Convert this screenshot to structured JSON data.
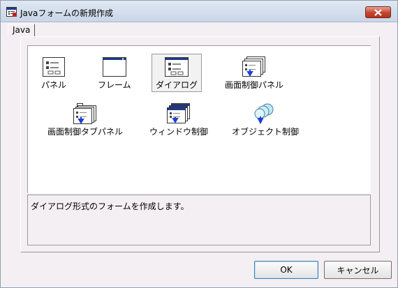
{
  "window": {
    "title": "Javaフォームの新規作成",
    "app_icon": "form-window-icon",
    "close_icon": "close-icon"
  },
  "tabs": [
    {
      "label": "Java",
      "active": true
    }
  ],
  "items": [
    {
      "label": "パネル",
      "icon": "panel-icon",
      "selected": false
    },
    {
      "label": "フレーム",
      "icon": "frame-icon",
      "selected": false
    },
    {
      "label": "ダイアログ",
      "icon": "dialog-icon",
      "selected": true
    },
    {
      "label": "画面制御パネル",
      "icon": "screen-control-panel-icon",
      "selected": false
    },
    {
      "label": "画面制御タブパネル",
      "icon": "screen-control-tab-panel-icon",
      "selected": false
    },
    {
      "label": "ウィンドウ制御",
      "icon": "window-control-icon",
      "selected": false
    },
    {
      "label": "オブジェクト制御",
      "icon": "object-control-icon",
      "selected": false
    }
  ],
  "description": "ダイアログ形式のフォームを作成します。",
  "buttons": {
    "ok": "OK",
    "cancel": "キャンセル"
  },
  "colors": {
    "titlebar": "#c9d6e6",
    "close": "#c7452e",
    "arrow": "#1f3fd8",
    "dialog_bg": "#f4eff3"
  }
}
